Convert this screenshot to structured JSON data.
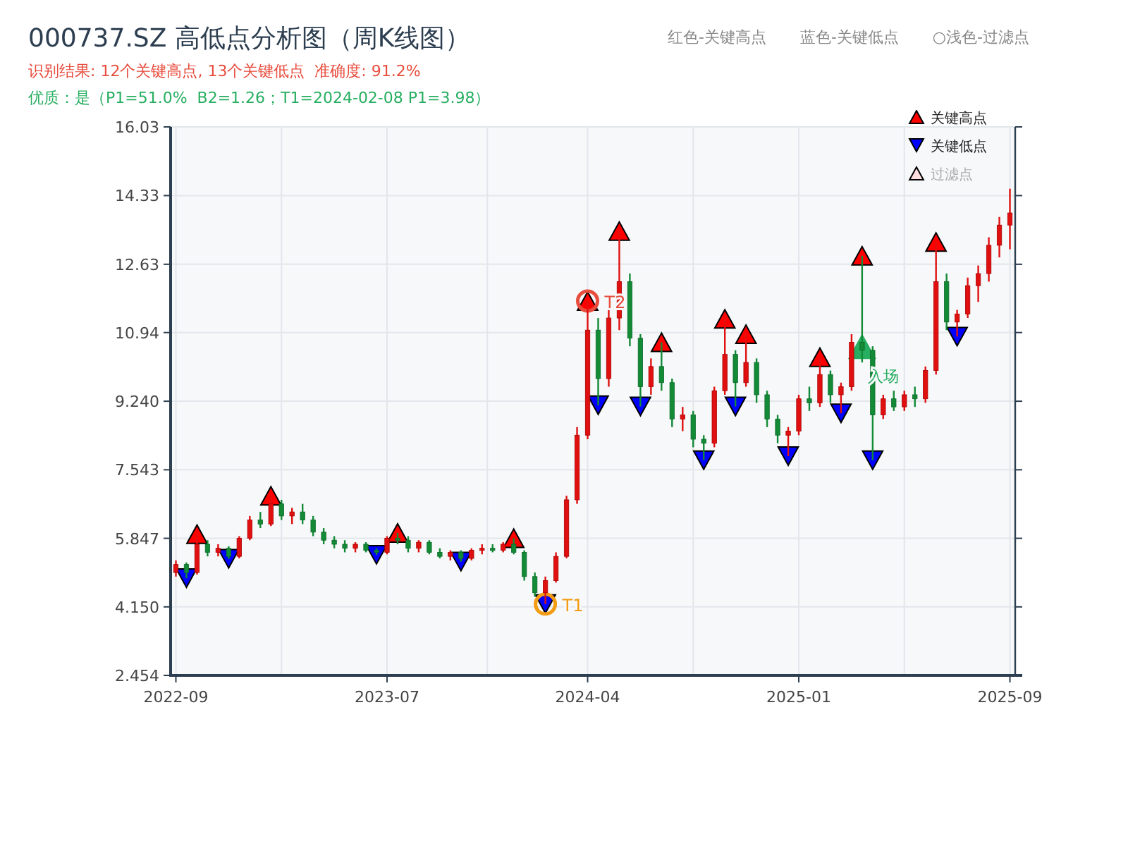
{
  "title": "000737.SZ 高低点分析图（周K线图）",
  "header_legend": [
    "红色-关键高点",
    "蓝色-关键低点",
    "○浅色-过滤点"
  ],
  "result_line": "识别结果: 12个关键高点, 13个关键低点  准确度: 91.2%",
  "quality_line": "优质：是（P1=51.0%  B2=1.26；T1=2024-02-08 P1=3.98）",
  "series_styles": [
    {
      "kind": "high"
    },
    {
      "kind": "low"
    },
    {
      "kind": "circle-low"
    },
    {
      "kind": "circle-high"
    },
    {
      "kind": "entry"
    }
  ],
  "filtered_legend": "过滤点",
  "chart_data": {
    "type": "candlestick",
    "grid": true,
    "legend": "upper right",
    "categories": [
      "2022-09",
      null,
      null,
      null,
      null,
      null,
      null,
      null,
      null,
      null,
      null,
      null,
      null,
      null,
      null,
      null,
      null,
      null,
      null,
      null,
      "2023-07",
      null,
      null,
      null,
      null,
      null,
      null,
      null,
      null,
      null,
      null,
      null,
      null,
      null,
      null,
      null,
      null,
      null,
      null,
      "2024-04",
      null,
      null,
      null,
      null,
      null,
      null,
      null,
      null,
      null,
      null,
      null,
      null,
      null,
      null,
      null,
      null,
      null,
      null,
      null,
      "2025-01",
      null,
      null,
      null,
      null,
      null,
      null,
      null,
      null,
      null,
      null,
      null,
      null,
      null,
      null,
      null,
      null,
      null,
      null,
      null,
      "2025-09"
    ],
    "ylim": [
      2.454,
      16.03
    ],
    "yticks": [
      {
        "value": 16.03,
        "label": "16.03"
      },
      {
        "value": 14.33,
        "label": "14.33"
      },
      {
        "value": 12.63,
        "label": "12.63"
      },
      {
        "value": 10.94,
        "label": "10.94"
      },
      {
        "value": 9.24,
        "label": "9.240"
      },
      {
        "value": 7.543,
        "label": "7.543"
      },
      {
        "value": 5.847,
        "label": "5.847"
      },
      {
        "value": 4.15,
        "label": "4.150"
      },
      {
        "value": 2.454,
        "label": "2.454"
      }
    ],
    "ohlc": [
      [
        5.0,
        5.3,
        4.9,
        5.2
      ],
      [
        5.2,
        5.25,
        4.86,
        5.0
      ],
      [
        5.0,
        5.95,
        4.95,
        5.7
      ],
      [
        5.7,
        5.8,
        5.4,
        5.5
      ],
      [
        5.5,
        5.7,
        5.4,
        5.6
      ],
      [
        5.6,
        5.65,
        5.34,
        5.4
      ],
      [
        5.4,
        5.9,
        5.35,
        5.85
      ],
      [
        5.85,
        6.4,
        5.8,
        6.3
      ],
      [
        6.3,
        6.5,
        6.1,
        6.2
      ],
      [
        6.2,
        6.9,
        6.15,
        6.7
      ],
      [
        6.7,
        6.8,
        6.3,
        6.4
      ],
      [
        6.4,
        6.6,
        6.2,
        6.5
      ],
      [
        6.5,
        6.7,
        6.2,
        6.3
      ],
      [
        6.3,
        6.4,
        5.9,
        6.0
      ],
      [
        6.0,
        6.1,
        5.7,
        5.8
      ],
      [
        5.8,
        5.9,
        5.6,
        5.7
      ],
      [
        5.7,
        5.8,
        5.5,
        5.6
      ],
      [
        5.6,
        5.75,
        5.5,
        5.7
      ],
      [
        5.7,
        5.75,
        5.5,
        5.55
      ],
      [
        5.55,
        5.6,
        5.44,
        5.5
      ],
      [
        5.5,
        5.9,
        5.45,
        5.85
      ],
      [
        5.85,
        5.98,
        5.7,
        5.8
      ],
      [
        5.8,
        5.9,
        5.5,
        5.6
      ],
      [
        5.6,
        5.8,
        5.5,
        5.75
      ],
      [
        5.75,
        5.8,
        5.45,
        5.5
      ],
      [
        5.5,
        5.6,
        5.35,
        5.4
      ],
      [
        5.4,
        5.55,
        5.3,
        5.5
      ],
      [
        5.5,
        5.55,
        5.27,
        5.35
      ],
      [
        5.35,
        5.6,
        5.3,
        5.55
      ],
      [
        5.55,
        5.7,
        5.45,
        5.6
      ],
      [
        5.6,
        5.7,
        5.5,
        5.55
      ],
      [
        5.55,
        5.75,
        5.5,
        5.7
      ],
      [
        5.7,
        5.85,
        5.45,
        5.5
      ],
      [
        5.5,
        5.55,
        4.8,
        4.9
      ],
      [
        4.9,
        5.0,
        4.4,
        4.5
      ],
      [
        4.5,
        4.9,
        4.22,
        4.8
      ],
      [
        4.8,
        5.5,
        4.75,
        5.4
      ],
      [
        5.4,
        6.9,
        5.35,
        6.8
      ],
      [
        6.8,
        8.6,
        6.7,
        8.4
      ],
      [
        8.4,
        11.72,
        8.3,
        11.0
      ],
      [
        11.0,
        11.3,
        9.14,
        9.8
      ],
      [
        9.8,
        11.5,
        9.6,
        11.3
      ],
      [
        11.3,
        13.45,
        11.0,
        12.2
      ],
      [
        12.2,
        12.4,
        10.6,
        10.8
      ],
      [
        10.8,
        10.9,
        9.11,
        9.6
      ],
      [
        9.6,
        10.3,
        9.4,
        10.1
      ],
      [
        10.1,
        10.7,
        9.5,
        9.7
      ],
      [
        9.7,
        9.8,
        8.6,
        8.8
      ],
      [
        8.8,
        9.1,
        8.5,
        8.9
      ],
      [
        8.9,
        9.0,
        8.1,
        8.3
      ],
      [
        8.3,
        8.4,
        7.78,
        8.2
      ],
      [
        8.2,
        9.6,
        8.1,
        9.5
      ],
      [
        9.5,
        11.28,
        9.4,
        10.4
      ],
      [
        10.4,
        10.5,
        9.11,
        9.7
      ],
      [
        9.7,
        10.9,
        9.6,
        10.2
      ],
      [
        10.2,
        10.3,
        9.2,
        9.4
      ],
      [
        9.4,
        9.5,
        8.6,
        8.8
      ],
      [
        8.8,
        8.9,
        8.2,
        8.4
      ],
      [
        8.4,
        8.6,
        7.88,
        8.5
      ],
      [
        8.5,
        9.4,
        8.4,
        9.3
      ],
      [
        9.3,
        9.6,
        9.0,
        9.2
      ],
      [
        9.2,
        10.33,
        9.1,
        9.9
      ],
      [
        9.9,
        10.0,
        9.2,
        9.4
      ],
      [
        9.4,
        9.7,
        8.94,
        9.6
      ],
      [
        9.6,
        10.9,
        9.5,
        10.7
      ],
      [
        10.7,
        12.84,
        10.2,
        10.5
      ],
      [
        10.5,
        10.6,
        7.78,
        8.9
      ],
      [
        8.9,
        9.4,
        8.8,
        9.3
      ],
      [
        9.3,
        9.5,
        9.0,
        9.1
      ],
      [
        9.1,
        9.5,
        9.0,
        9.4
      ],
      [
        9.4,
        9.6,
        9.1,
        9.3
      ],
      [
        9.3,
        10.1,
        9.2,
        10.0
      ],
      [
        10.0,
        13.18,
        9.9,
        12.2
      ],
      [
        12.2,
        12.4,
        11.0,
        11.2
      ],
      [
        11.2,
        11.5,
        10.84,
        11.4
      ],
      [
        11.4,
        12.3,
        11.3,
        12.1
      ],
      [
        12.1,
        12.6,
        11.7,
        12.4
      ],
      [
        12.4,
        13.3,
        12.2,
        13.1
      ],
      [
        13.1,
        13.8,
        12.8,
        13.6
      ],
      [
        13.6,
        14.5,
        13.0,
        13.9
      ]
    ],
    "series": [
      {
        "name": "关键高点",
        "type": "scatter",
        "color": "#ff0000",
        "values": [
          null,
          null,
          5.95,
          null,
          null,
          null,
          null,
          null,
          null,
          6.9,
          null,
          null,
          null,
          null,
          null,
          null,
          null,
          null,
          null,
          null,
          null,
          5.98,
          null,
          null,
          null,
          null,
          null,
          null,
          null,
          null,
          null,
          null,
          5.85,
          null,
          null,
          null,
          null,
          null,
          null,
          11.72,
          null,
          null,
          13.45,
          null,
          null,
          null,
          10.7,
          null,
          null,
          null,
          null,
          null,
          11.28,
          null,
          10.9,
          null,
          null,
          null,
          null,
          null,
          null,
          10.33,
          null,
          null,
          null,
          12.84,
          null,
          null,
          null,
          null,
          null,
          null,
          13.18,
          null,
          null,
          null,
          null,
          null,
          null,
          null
        ]
      },
      {
        "name": "关键低点",
        "type": "scatter",
        "color": "#0000ff",
        "values": [
          null,
          4.86,
          null,
          null,
          null,
          5.34,
          null,
          null,
          null,
          null,
          null,
          null,
          null,
          null,
          null,
          null,
          null,
          null,
          null,
          5.44,
          null,
          null,
          null,
          null,
          null,
          null,
          null,
          5.27,
          null,
          null,
          null,
          null,
          null,
          null,
          null,
          4.22,
          null,
          null,
          null,
          null,
          9.14,
          null,
          null,
          null,
          9.11,
          null,
          null,
          null,
          null,
          null,
          7.78,
          null,
          null,
          9.11,
          null,
          null,
          null,
          null,
          7.88,
          null,
          null,
          null,
          null,
          8.94,
          null,
          null,
          7.78,
          null,
          null,
          null,
          null,
          null,
          null,
          null,
          10.84,
          null,
          null,
          null,
          null,
          null
        ]
      },
      {
        "name": "T1",
        "type": "scatter",
        "color": "#f39c12",
        "values": [
          null,
          null,
          null,
          null,
          null,
          null,
          null,
          null,
          null,
          null,
          null,
          null,
          null,
          null,
          null,
          null,
          null,
          null,
          null,
          null,
          null,
          null,
          null,
          null,
          null,
          null,
          null,
          null,
          null,
          null,
          null,
          null,
          null,
          null,
          null,
          4.22,
          null,
          null,
          null,
          null,
          null,
          null,
          null,
          null,
          null,
          null,
          null,
          null,
          null,
          null,
          null,
          null,
          null,
          null,
          null,
          null,
          null,
          null,
          null,
          null,
          null,
          null,
          null,
          null,
          null,
          null,
          null,
          null,
          null,
          null,
          null,
          null,
          null,
          null,
          null,
          null,
          null,
          null,
          null,
          null
        ]
      },
      {
        "name": "T2",
        "type": "scatter",
        "color": "#e74c3c",
        "values": [
          null,
          null,
          null,
          null,
          null,
          null,
          null,
          null,
          null,
          null,
          null,
          null,
          null,
          null,
          null,
          null,
          null,
          null,
          null,
          null,
          null,
          null,
          null,
          null,
          null,
          null,
          null,
          null,
          null,
          null,
          null,
          null,
          null,
          null,
          null,
          null,
          null,
          null,
          null,
          11.72,
          null,
          null,
          null,
          null,
          null,
          null,
          null,
          null,
          null,
          null,
          null,
          null,
          null,
          null,
          null,
          null,
          null,
          null,
          null,
          null,
          null,
          null,
          null,
          null,
          null,
          null,
          null,
          null,
          null,
          null,
          null,
          null,
          null,
          null,
          null,
          null,
          null,
          null,
          null,
          null
        ]
      },
      {
        "name": "入场",
        "type": "scatter",
        "color": "#27ae60",
        "values": [
          null,
          null,
          null,
          null,
          null,
          null,
          null,
          null,
          null,
          null,
          null,
          null,
          null,
          null,
          null,
          null,
          null,
          null,
          null,
          null,
          null,
          null,
          null,
          null,
          null,
          null,
          null,
          null,
          null,
          null,
          null,
          null,
          null,
          null,
          null,
          null,
          null,
          null,
          null,
          null,
          null,
          null,
          null,
          null,
          null,
          null,
          null,
          null,
          null,
          null,
          null,
          null,
          null,
          null,
          null,
          null,
          null,
          null,
          null,
          null,
          null,
          null,
          null,
          null,
          null,
          10.6,
          null,
          null,
          null,
          null,
          null,
          null,
          null,
          null,
          null,
          null,
          null,
          null,
          null,
          null
        ]
      }
    ]
  }
}
